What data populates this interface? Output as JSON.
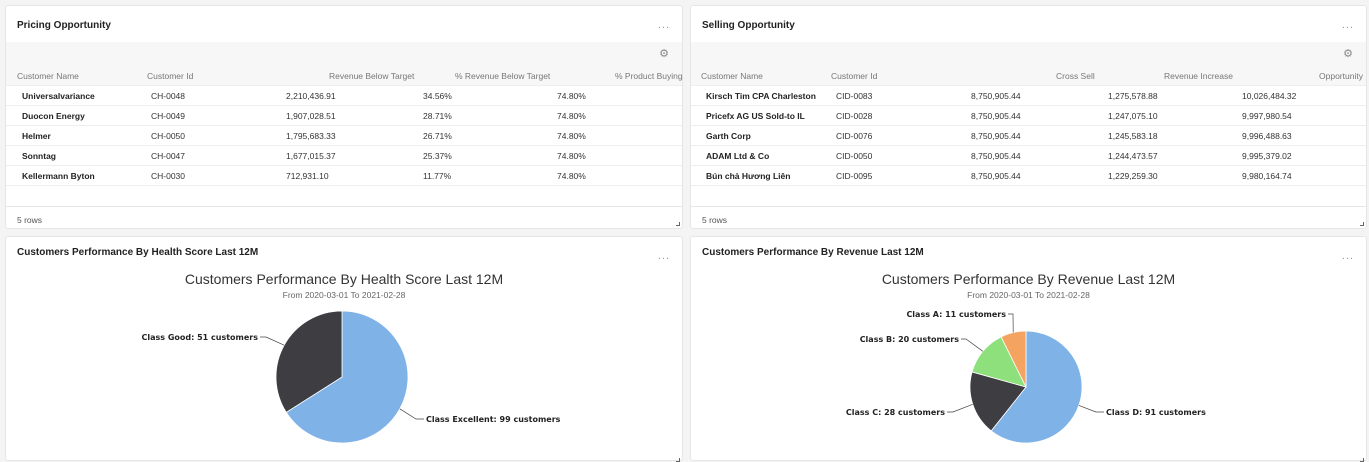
{
  "pricing": {
    "title": "Pricing Opportunity",
    "menu": "...",
    "columns": [
      "Customer Name",
      "Customer Id",
      "Revenue Below Target",
      "% Revenue Below Target",
      "% Product Buying"
    ],
    "rows": [
      [
        "Universalvariance",
        "CH-0048",
        "2,210,436.91",
        "34.56%",
        "74.80%"
      ],
      [
        "Duocon Energy",
        "CH-0049",
        "1,907,028.51",
        "28.71%",
        "74.80%"
      ],
      [
        "Helmer",
        "CH-0050",
        "1,795,683.33",
        "26.71%",
        "74.80%"
      ],
      [
        "Sonntag",
        "CH-0047",
        "1,677,015.37",
        "25.37%",
        "74.80%"
      ],
      [
        "Kellermann Byton",
        "CH-0030",
        "712,931.10",
        "11.77%",
        "74.80%"
      ]
    ],
    "footer": "5 rows"
  },
  "selling": {
    "title": "Selling Opportunity",
    "menu": "...",
    "columns": [
      "Customer Name",
      "Customer Id",
      "Cross Sell",
      "Revenue Increase",
      "Opportunity"
    ],
    "rows": [
      [
        "Kirsch Tim CPA Charleston",
        "CID-0083",
        "8,750,905.44",
        "1,275,578.88",
        "10,026,484.32"
      ],
      [
        "Pricefx AG US Sold-to IL",
        "CID-0028",
        "8,750,905.44",
        "1,247,075.10",
        "9,997,980.54"
      ],
      [
        "Garth Corp",
        "CID-0076",
        "8,750,905.44",
        "1,245,583.18",
        "9,996,488.63"
      ],
      [
        "ADAM Ltd & Co",
        "CID-0050",
        "8,750,905.44",
        "1,244,473.57",
        "9,995,379.02"
      ],
      [
        "Bún chả Hương Liên",
        "CID-0095",
        "8,750,905.44",
        "1,229,259.30",
        "9,980,164.74"
      ]
    ],
    "footer": "5 rows"
  },
  "health": {
    "panel_title": "Customers Performance By Health Score Last 12M",
    "menu": "...",
    "labels": [
      "Class Excellent: 99 customers",
      "Class Good: 51 customers"
    ]
  },
  "revenue": {
    "panel_title": "Customers Performance By Revenue Last 12M",
    "menu": "...",
    "labels": [
      "Class D: 91 customers",
      "Class C: 28 customers",
      "Class B: 20 customers",
      "Class A: 11 customers"
    ]
  },
  "gear_icon": "gear-icon",
  "chart_data": [
    {
      "type": "pie",
      "title": "Customers Performance By Health Score Last 12M",
      "subtitle": "From 2020-03-01 To 2021-02-28",
      "categories": [
        "Class Excellent",
        "Class Good"
      ],
      "values": [
        99,
        51
      ],
      "colors": [
        "#7fb3e8",
        "#3d3d42"
      ]
    },
    {
      "type": "pie",
      "title": "Customers Performance By Revenue Last 12M",
      "subtitle": "From 2020-03-01 To 2021-02-28",
      "categories": [
        "Class D",
        "Class C",
        "Class B",
        "Class A"
      ],
      "values": [
        91,
        28,
        20,
        11
      ],
      "colors": [
        "#7fb3e8",
        "#3d3d42",
        "#8ee07d",
        "#f4a460"
      ]
    }
  ]
}
